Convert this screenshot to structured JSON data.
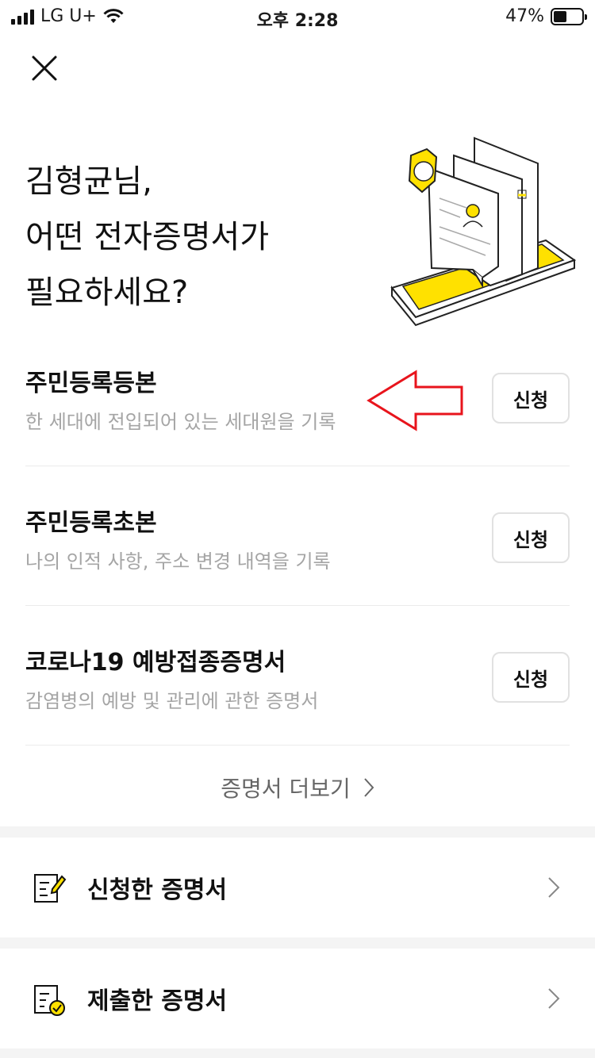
{
  "status_bar": {
    "carrier": "LG U+",
    "time": "오후 2:28",
    "battery_percent": "47%",
    "battery_level": 0.47
  },
  "header": {
    "close_icon": "close-icon"
  },
  "headline": {
    "line1": "김형균님,",
    "line2_highlight": "어떤 전자증명서",
    "line2_rest": "가",
    "line3": "필요하세요?"
  },
  "certificates": [
    {
      "title": "주민등록등본",
      "description": "한 세대에 전입되어 있는 세대원을 기록",
      "button": "신청"
    },
    {
      "title": "주민등록초본",
      "description": "나의 인적 사항, 주소 변경 내역을 기록",
      "button": "신청"
    },
    {
      "title": "코로나19 예방접종증명서",
      "description": "감염병의 예방 및 관리에 관한 증명서",
      "button": "신청"
    }
  ],
  "more_link": "증명서 더보기",
  "menu": [
    {
      "label": "신청한 증명서",
      "icon": "edit-document-icon"
    },
    {
      "label": "제출한 증명서",
      "icon": "submitted-document-icon"
    }
  ],
  "colors": {
    "accent_yellow": "#ffe100",
    "annotation_red": "#e8141c",
    "muted_text": "#a5a5a5"
  }
}
